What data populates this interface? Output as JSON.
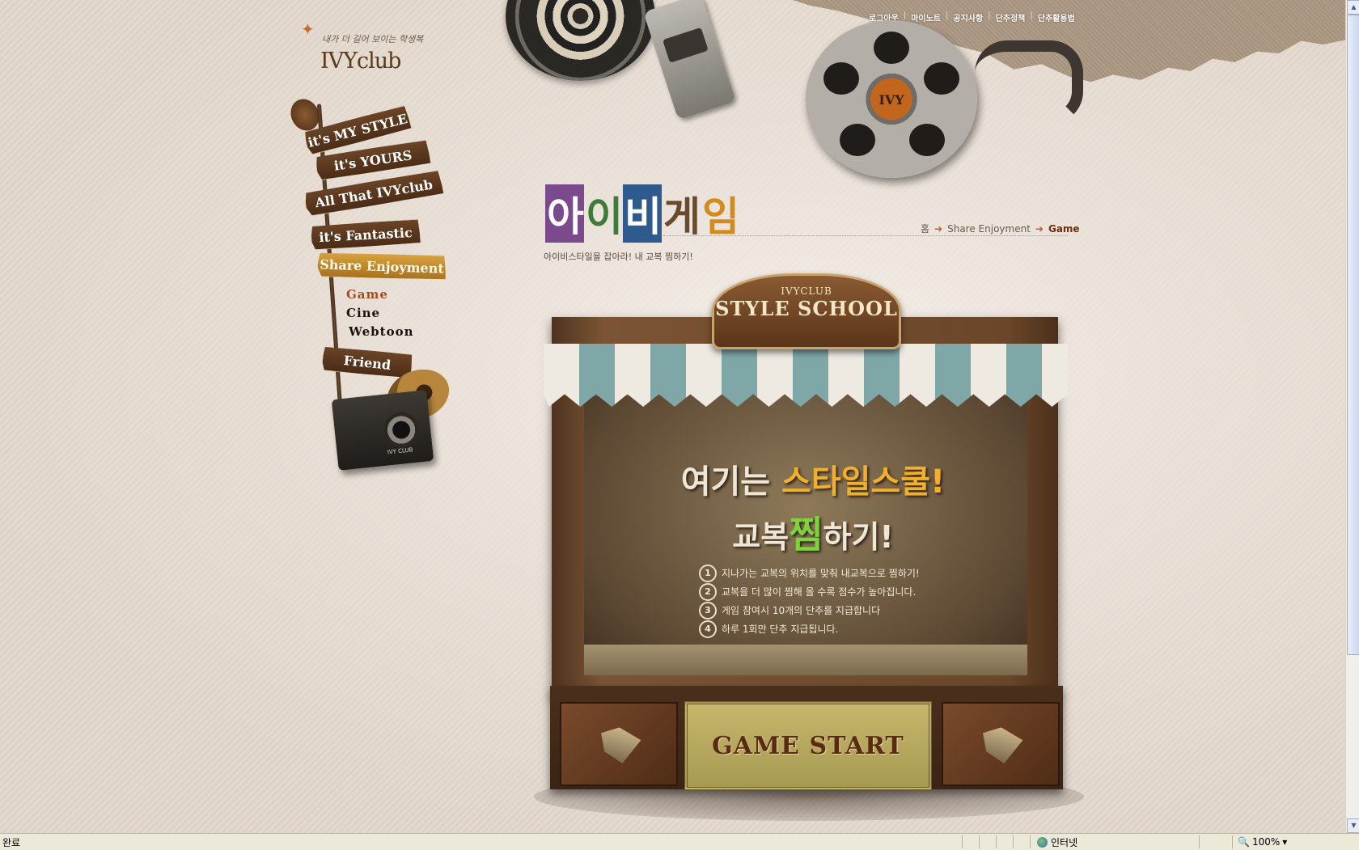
{
  "top_links": [
    "로그아웃",
    "마이노트",
    "공지사항",
    "단추정책",
    "단추활용법"
  ],
  "logo": {
    "tagline": "내가 더 길어 보이는 학생복",
    "brand": "IVYclub",
    "reel_label": "IVY"
  },
  "nav": {
    "signs": [
      "it's MY STYLE",
      "it's YOURS",
      "All That IVYclub",
      "it's Fantastic",
      "Share Enjoyment",
      "Friend"
    ],
    "active_sign": "Share Enjoyment",
    "sub_items": [
      "Game",
      "Cine",
      "Webtoon"
    ],
    "active_sub": "Game",
    "camera_label": "IVY CLUB"
  },
  "page": {
    "title_chars": [
      "아",
      "이",
      "비",
      "게",
      "임"
    ],
    "breadcrumb": [
      "홈",
      "Share Enjoyment",
      "Game"
    ],
    "subtitle": "아이비스타일을 잡아라! 내 교복 찜하기!"
  },
  "booth": {
    "sign_small": "IVYCLUB",
    "sign_big": "STYLE SCHOOL",
    "headline1_pre": "여기는 ",
    "headline1_hl": "스타일스쿨!",
    "headline2_pre": "교복",
    "headline2_hl": "찜",
    "headline2_post": "하기!",
    "rules": [
      "지나가는 교복의 위치를 맞춰 내교복으로 찜하기!",
      "교복을 더 많이 찜해 올 수록 점수가 높아집니다.",
      "게임 참여시 10개의 단추를 지급합니다",
      "하루 1회만 단추 지급됩니다."
    ],
    "start_label": "GAME START"
  },
  "statusbar": {
    "status": "완료",
    "zone": "인터넷",
    "zoom": "100%"
  },
  "colors": {
    "title": [
      "#7a4a8c",
      "#3e7b3a",
      "#2f5a8e",
      "#6a4a2c",
      "#d48a1c"
    ],
    "awning_stripe": "#7fa7a8",
    "sign_active": "#d9a23e"
  }
}
